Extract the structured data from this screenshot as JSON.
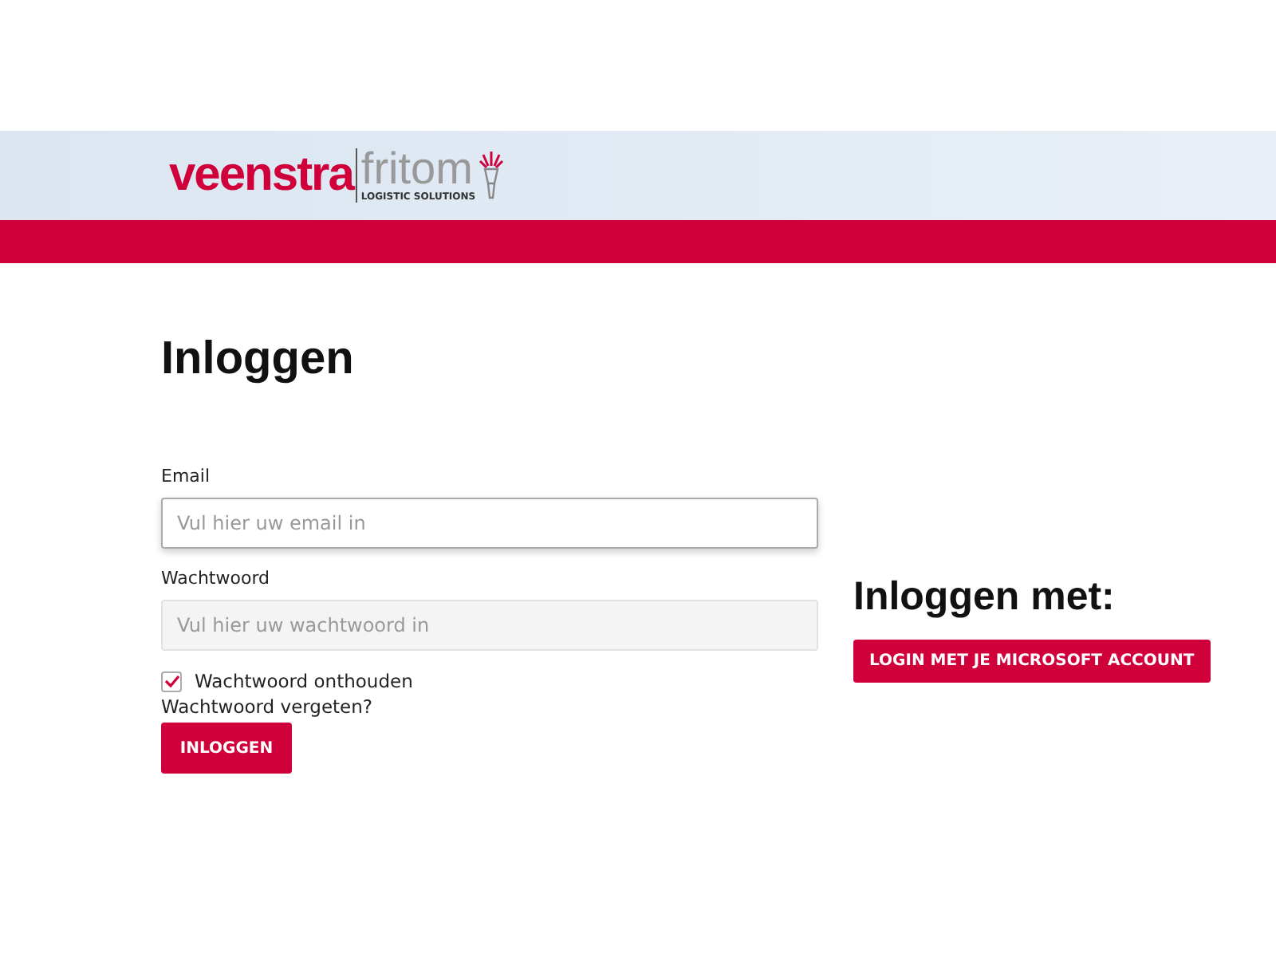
{
  "logo": {
    "brand": "veenstra",
    "partner": "fritom",
    "tagline": "LOGISTIC SOLUTIONS"
  },
  "title": "Inloggen",
  "fields": [
    {
      "label": "Email",
      "placeholder": "Vul hier uw email in",
      "focused": true
    },
    {
      "label": "Wachtwoord",
      "placeholder": "Vul hier uw wachtwoord in",
      "focused": false
    }
  ],
  "remember": {
    "label": "Wachtwoord onthouden",
    "checked": true
  },
  "forgot_link": "Wachtwoord vergeten?",
  "login_button": "INLOGGEN",
  "alt_login": {
    "title": "Inloggen met:",
    "button": "LOGIN MET JE MICROSOFT ACCOUNT"
  }
}
